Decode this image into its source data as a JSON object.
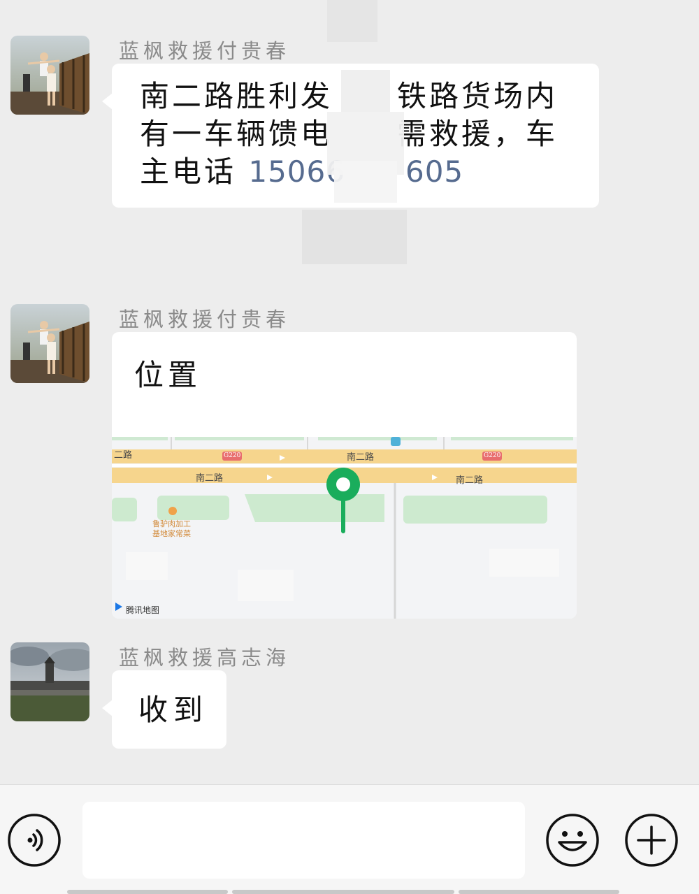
{
  "messages": [
    {
      "sender": "蓝枫救援付贵春",
      "text_prefix": "南二路胜利发　　铁路货场内有一车辆馈电　　需救援，车主电话 ",
      "phone": "15066　　605"
    },
    {
      "sender": "蓝枫救援付贵春",
      "location_label": "位置",
      "map": {
        "road_labels": [
          "二路",
          "南二路",
          "南二路",
          "南二路"
        ],
        "highway_shields": [
          "G220",
          "G220"
        ],
        "poi_name_line1": "鲁驴肉加工",
        "poi_name_line2": "基地家常菜",
        "attribution": "腾讯地图",
        "pin_color": "#1aad5c"
      }
    },
    {
      "sender": "蓝枫救援高志海",
      "text": "收到"
    }
  ],
  "input_bar": {
    "voice_icon": "voice-icon",
    "emoji_icon": "emoji-icon",
    "plus_icon": "plus-icon",
    "input_value": ""
  },
  "colors": {
    "chat_background": "#ededed",
    "bubble": "#ffffff",
    "phone_link": "#566b8f"
  }
}
